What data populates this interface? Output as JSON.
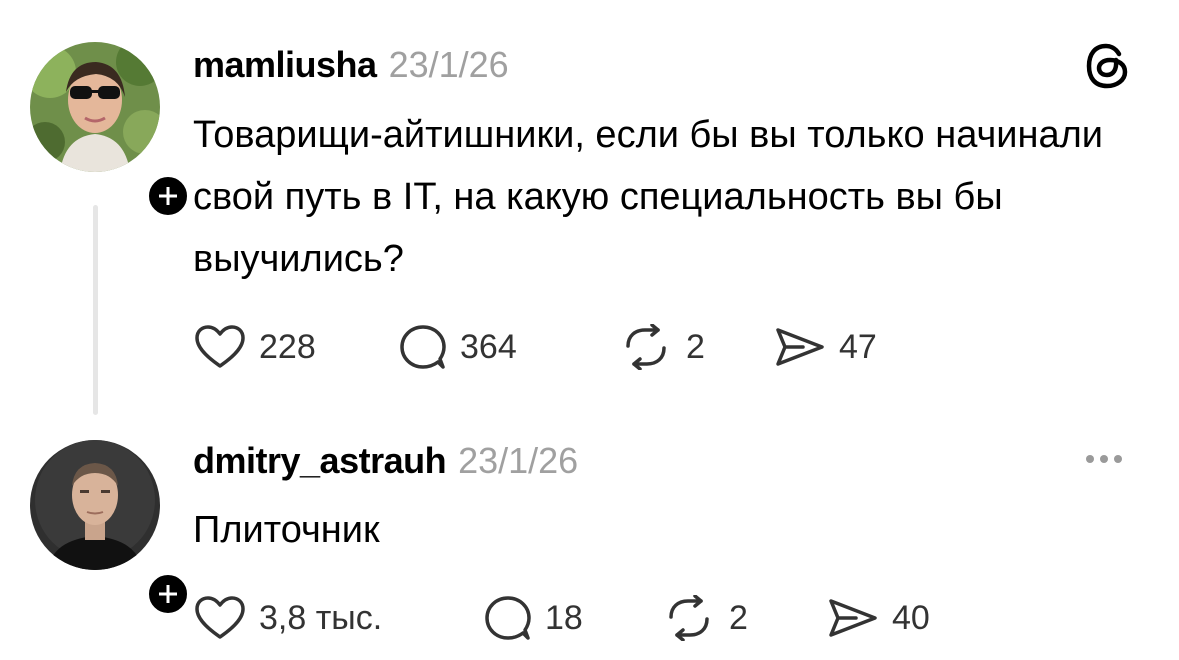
{
  "posts": [
    {
      "username": "mamliusha",
      "date": "23/1/26",
      "text": "Товарищи-айтишники, если бы вы только начинали свой путь в IT, на какую специальность вы бы выучились?",
      "likes": "228",
      "comments": "364",
      "reposts": "2",
      "shares": "47"
    },
    {
      "username": "dmitry_astrauh",
      "date": "23/1/26",
      "text": "Плиточник",
      "likes": "3,8 тыс.",
      "comments": "18",
      "reposts": "2",
      "shares": "40"
    }
  ],
  "icons": {
    "header_logo": "threads-logo-icon",
    "more": "more-options-icon",
    "like": "heart-icon",
    "comment": "comment-bubble-icon",
    "repost": "repost-icon",
    "share": "share-send-icon",
    "follow": "plus-icon"
  },
  "colors": {
    "text": "#000000",
    "muted": "#a0a0a0",
    "thread_line": "#e6e6e6"
  }
}
